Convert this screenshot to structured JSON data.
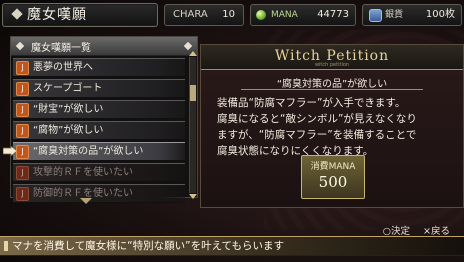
{
  "header": {
    "title": "魔女嘆願",
    "chara_label": "CHARA",
    "chara_value": "10",
    "mana_label": "MANA",
    "mana_value": "44773",
    "coin_label": "銀貨",
    "coin_value": "100枚"
  },
  "list": {
    "title": "魔女嘆願一覧",
    "items": [
      {
        "label": "悪夢の世界へ",
        "state": "normal"
      },
      {
        "label": "スケープゴート",
        "state": "normal"
      },
      {
        "label": "“財宝”が欲しい",
        "state": "normal"
      },
      {
        "label": "“腐物”が欲しい",
        "state": "normal"
      },
      {
        "label": "“腐臭対策の品”が欲しい",
        "state": "selected"
      },
      {
        "label": "攻撃的ＲＦを使いたい",
        "state": "disabled"
      },
      {
        "label": "防御的ＲＦを使いたい",
        "state": "disabled"
      }
    ],
    "icon_glyph": "J"
  },
  "detail": {
    "heading": "Witch Petition",
    "heading_sub": "witch petition",
    "title": "“腐臭対策の品”が欲しい",
    "description": "装備品“防腐マフラー”が入手できます。\n腐臭になると“敵シンボル”が見えなくなり\nますが、“防腐マフラー”を装備することで\n腐臭状態になりにくくなります。",
    "cost_label": "消費MANA",
    "cost_value": "500"
  },
  "controls": {
    "confirm": "○決定",
    "back": "×戻る"
  },
  "help": {
    "text": "マナを消費して魔女様に“特別な願い”を叶えてもらいます"
  }
}
